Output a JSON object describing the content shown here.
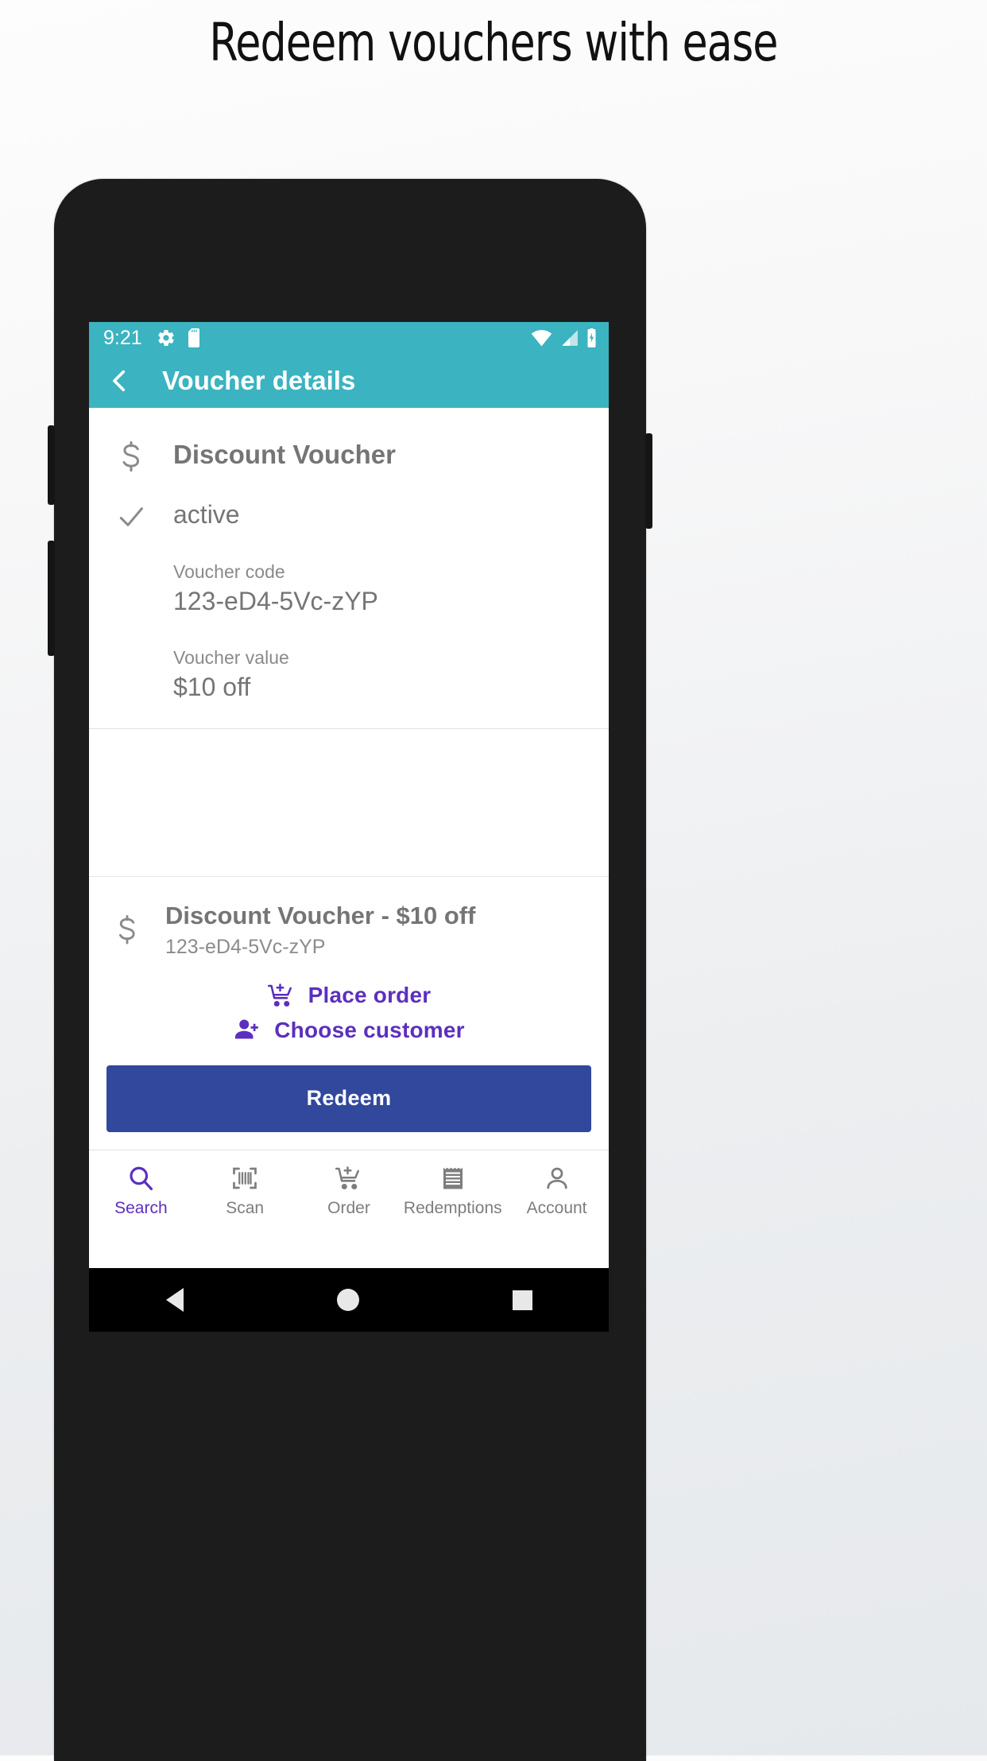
{
  "promo": {
    "title": "Redeem vouchers with ease"
  },
  "statusbar": {
    "time": "9:21",
    "left_icons": [
      "gear-icon",
      "sd-card-icon"
    ],
    "right_icons": [
      "wifi-icon",
      "cell-signal-icon",
      "battery-icon"
    ],
    "background": "#3bb3c0"
  },
  "appbar": {
    "back_icon": "chevron-left-icon",
    "title": "Voucher details",
    "background": "#3bb3c0"
  },
  "details": {
    "icon": "dollar-icon",
    "voucher_name": "Discount Voucher",
    "status_icon": "check-icon",
    "status": "active",
    "fields": [
      {
        "label": "Voucher code",
        "value": "123-eD4-5Vc-zYP"
      },
      {
        "label": "Voucher value",
        "value": "$10 off"
      }
    ]
  },
  "action": {
    "icon": "dollar-icon",
    "title": "Discount Voucher - $10 off",
    "subtitle": "123-eD4-5Vc-zYP",
    "links": [
      {
        "icon": "add-to-cart-icon",
        "label": "Place order"
      },
      {
        "icon": "add-person-icon",
        "label": "Choose customer"
      }
    ],
    "primary_button": "Redeem",
    "primary_button_color": "#32489c",
    "link_color": "#5c2fbe"
  },
  "bottom_nav": {
    "items": [
      {
        "icon": "search-icon",
        "label": "Search",
        "active": true
      },
      {
        "icon": "barcode-icon",
        "label": "Scan",
        "active": false
      },
      {
        "icon": "add-to-cart-icon",
        "label": "Order",
        "active": false
      },
      {
        "icon": "receipt-icon",
        "label": "Redemptions",
        "active": false
      },
      {
        "icon": "person-icon",
        "label": "Account",
        "active": false
      }
    ],
    "active_color": "#5c2fbe",
    "inactive_color": "#7d7d7d"
  },
  "android_nav": {
    "back": "back-triangle-icon",
    "home": "home-circle-icon",
    "recents": "recents-square-icon"
  }
}
